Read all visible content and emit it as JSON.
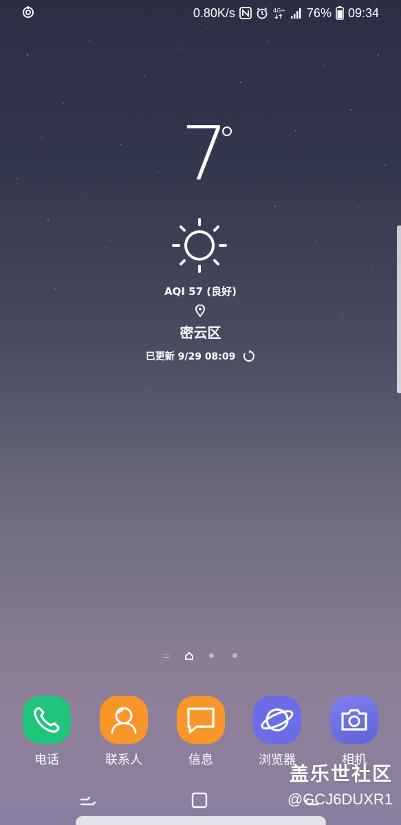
{
  "status_bar": {
    "left_icon": "sync-icon",
    "net_speed": "0.80K/s",
    "nfc_icon": "nfc-icon",
    "alarm_icon": "alarm-icon",
    "network_type": "4G+",
    "signal_icon": "signal-icon",
    "battery_percent": "76%",
    "battery_icon": "battery-icon",
    "time": "09:34"
  },
  "weather": {
    "temperature": "7",
    "condition_icon": "sun-icon",
    "aqi": "AQI 57 (良好)",
    "location_icon": "pin-icon",
    "location": "密云区",
    "updated": "已更新 9/29 08:09",
    "refresh_icon": "refresh-icon"
  },
  "page_indicator": {
    "pages": 4,
    "current": "home"
  },
  "dock": {
    "apps": [
      {
        "label": "电话",
        "icon": "phone-icon",
        "color": "#1fc57a"
      },
      {
        "label": "联系人",
        "icon": "contacts-icon",
        "color": "#f8962a"
      },
      {
        "label": "信息",
        "icon": "message-icon",
        "color": "#f8962a"
      },
      {
        "label": "浏览器",
        "icon": "browser-icon",
        "color": "#6b6de8"
      },
      {
        "label": "相机",
        "icon": "camera-icon",
        "color": "#6f71e6"
      }
    ]
  },
  "watermark": {
    "title": "盖乐世社区",
    "handle": "@GCJ6DUXR1"
  },
  "nav_bar": {
    "recent_icon": "recent-apps-icon",
    "home_icon": "home-icon",
    "back_icon": "back-icon"
  }
}
